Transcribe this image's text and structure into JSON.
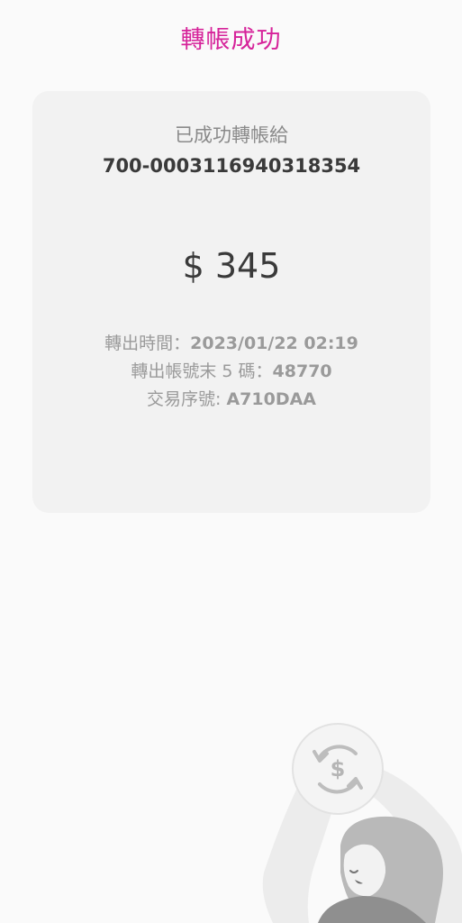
{
  "header": {
    "title": "轉帳成功"
  },
  "receipt": {
    "recipient_label": "已成功轉帳給",
    "recipient_account": "700-0003116940318354",
    "amount": "$ 345",
    "time_label": "轉出時間：",
    "time_value": "2023/01/22 02:19",
    "account_last5_label": "轉出帳號末 5 碼：",
    "account_last5_value": "48770",
    "serial_label": "交易序號: ",
    "serial_value": "A710DAA"
  },
  "illustration": {
    "icon": "transfer-cycle-dollar-icon"
  },
  "colors": {
    "accent": "#d6239a",
    "card_bg": "#f2f2f2",
    "page_bg": "#fafafa",
    "text_dark": "#3a3a3a",
    "text_muted": "#9a9a9a"
  }
}
